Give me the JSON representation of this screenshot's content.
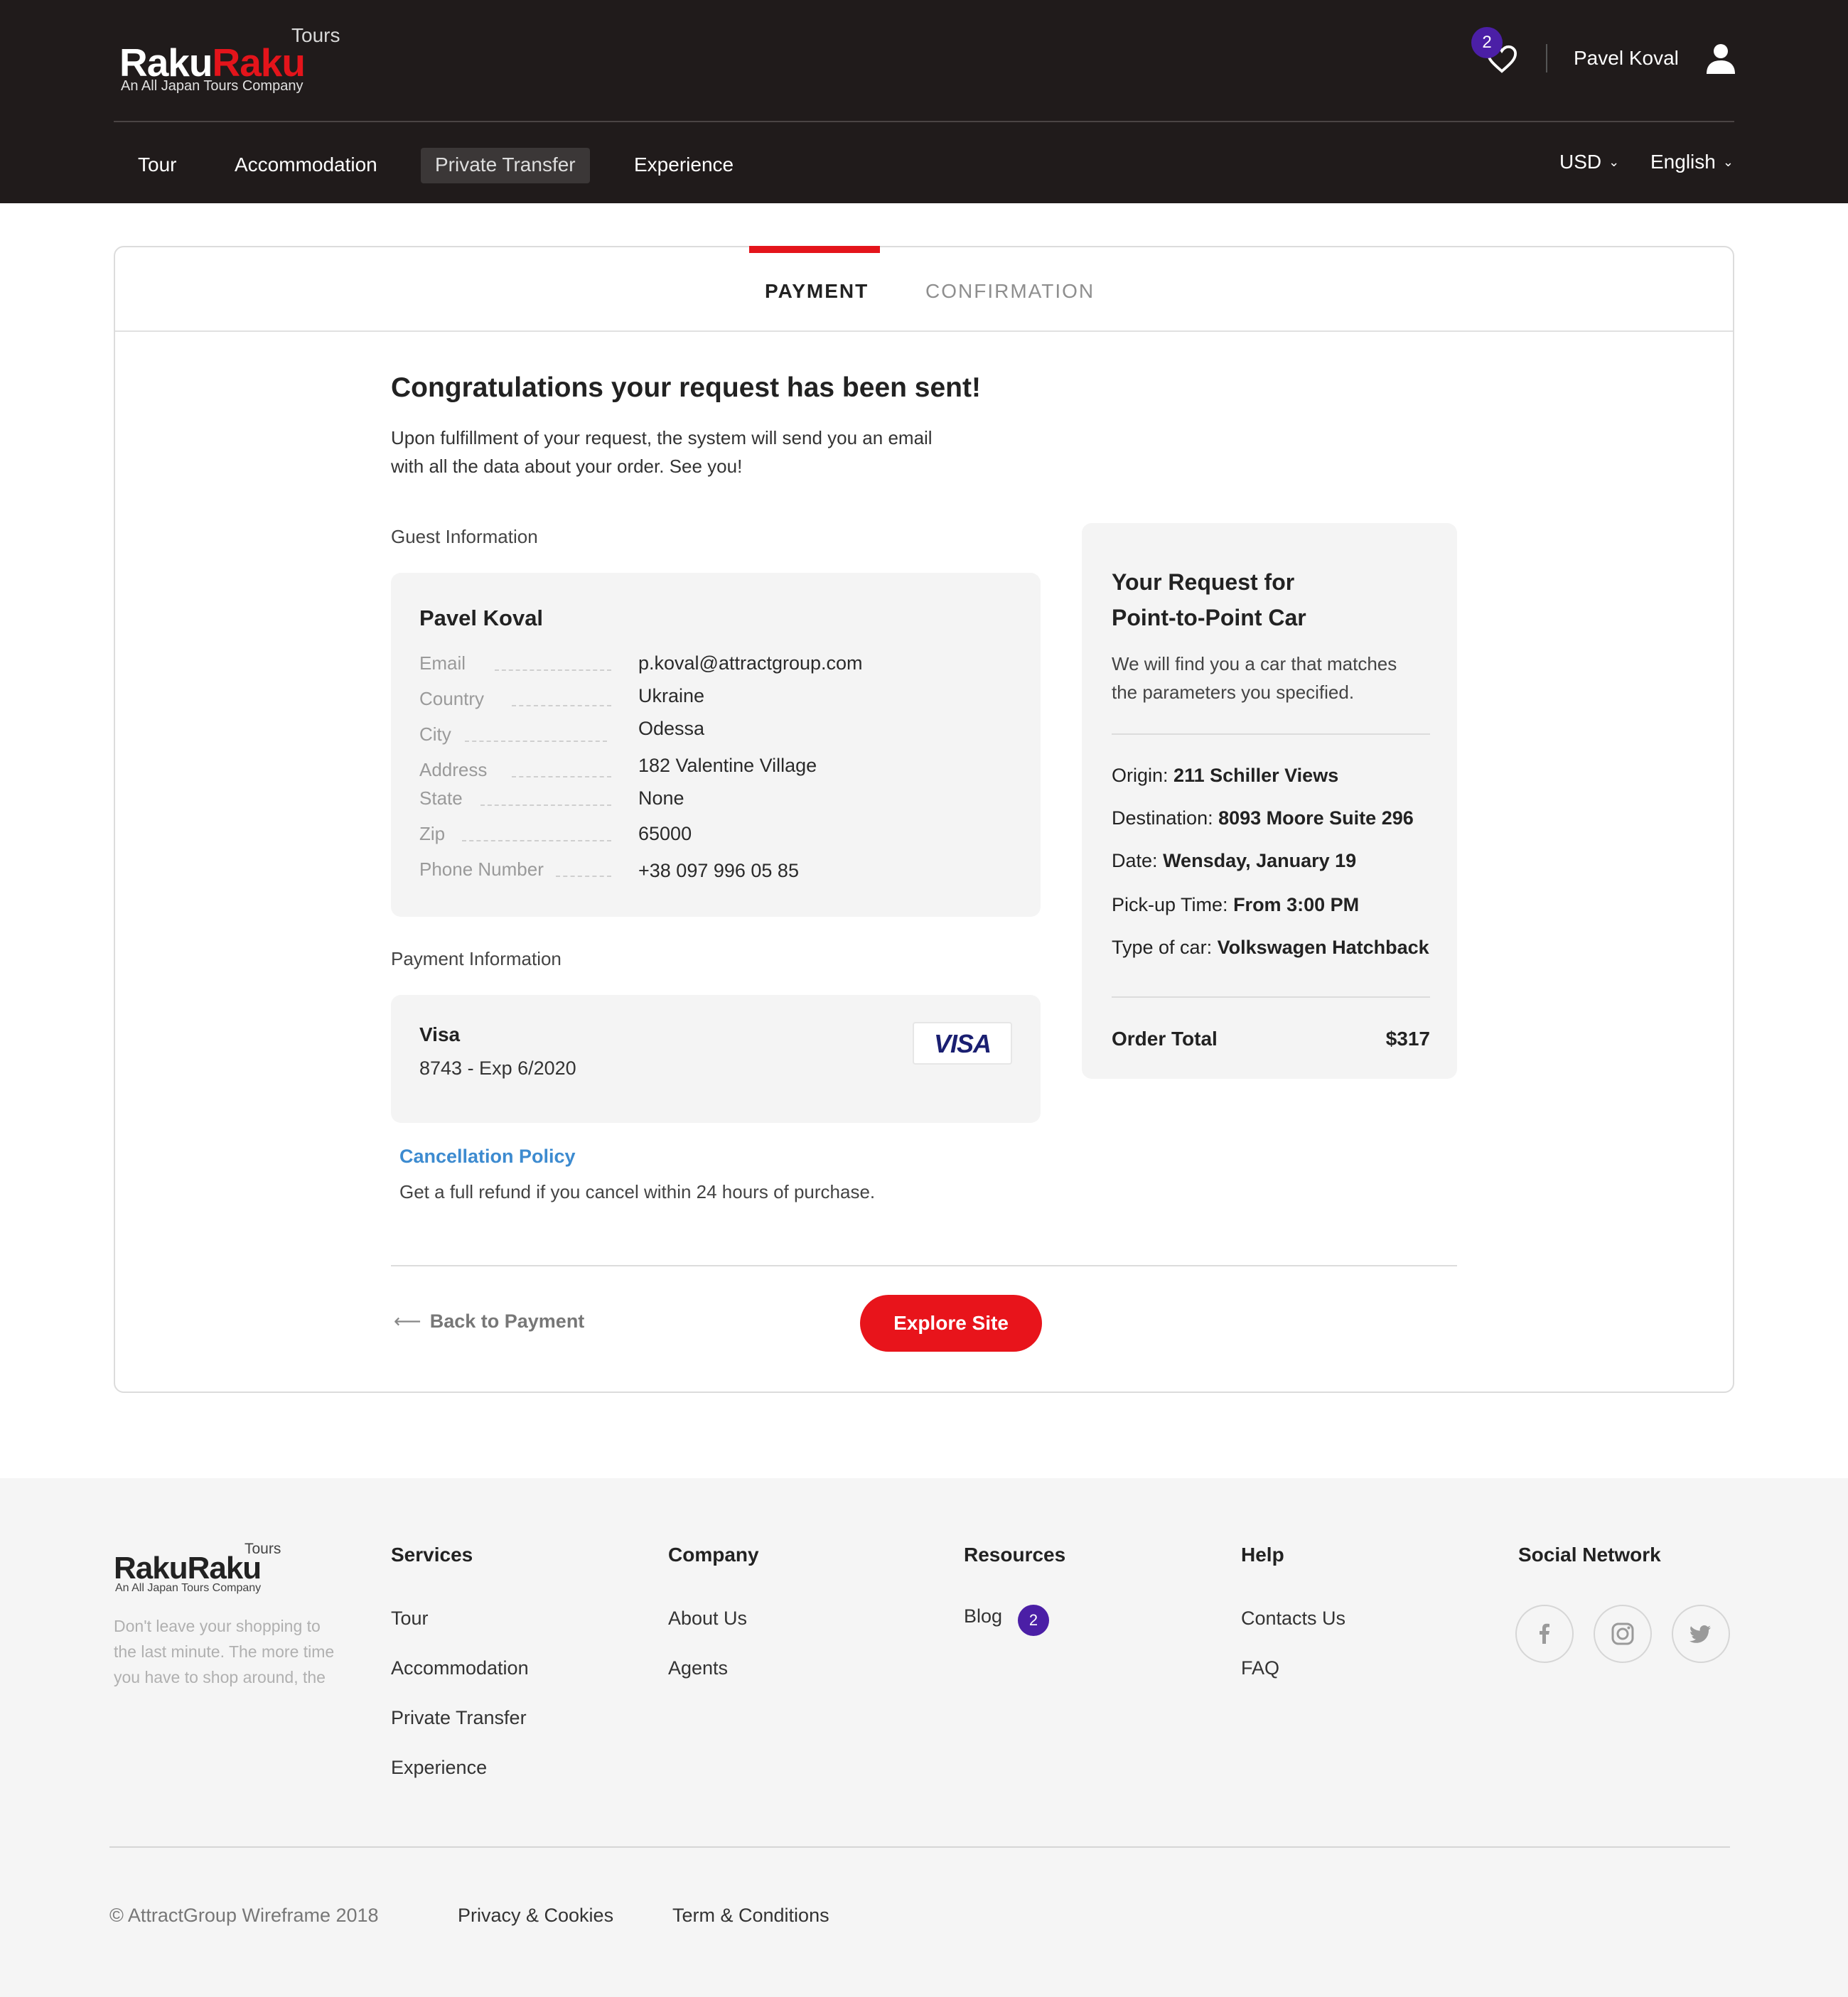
{
  "header": {
    "logo": {
      "tours": "Tours",
      "brand_white": "Raku",
      "brand_red": "Raku",
      "tagline": "An All Japan Tours Company"
    },
    "favorites_count": "2",
    "user_name": "Pavel Koval",
    "nav": [
      {
        "label": "Tour"
      },
      {
        "label": "Accommodation"
      },
      {
        "label": "Private Transfer",
        "active": true
      },
      {
        "label": "Experience"
      }
    ],
    "currency": "USD",
    "language": "English"
  },
  "steps": {
    "payment": "PAYMENT",
    "confirmation": "CONFIRMATION"
  },
  "confirmation": {
    "title": "Congratulations your request has been sent!",
    "intro_line1": "Upon fulfillment of your request, the system will send you an email",
    "intro_line2": "with all the data about your order. See you!"
  },
  "guest": {
    "section_label": "Guest Information",
    "name": "Pavel Koval",
    "rows": [
      {
        "label": "Email",
        "value": "p.koval@attractgroup.com"
      },
      {
        "label": "Country",
        "value": "Ukraine"
      },
      {
        "label": "City",
        "value": "Odessa"
      },
      {
        "label": "Address",
        "value": "182 Valentine Village"
      },
      {
        "label": "State",
        "value": "None"
      },
      {
        "label": "Zip",
        "value": "65000"
      },
      {
        "label": "Phone Number",
        "value": "+38 097 996 05 85"
      }
    ]
  },
  "payment": {
    "section_label": "Payment Information",
    "card_brand": "Visa",
    "card_details": "8743 - Exp 6/2020",
    "badge": "VISA"
  },
  "cancellation": {
    "title": "Cancellation Policy",
    "text": "Get a full refund if you cancel within 24 hours of purchase."
  },
  "request": {
    "title_line1": "Your Request for",
    "title_line2": "Point-to-Point Car",
    "desc_line1": "We will find you a car that matches",
    "desc_line2": "the parameters you specified.",
    "rows": [
      {
        "label": "Origin:",
        "value": "211 Schiller Views"
      },
      {
        "label": "Destination:",
        "value": "8093 Moore Suite 296"
      },
      {
        "label": "Date:",
        "value": "Wensday, January 19"
      },
      {
        "label": "Pick-up Time:",
        "value": "From 3:00 PM"
      },
      {
        "label": "Type of car:",
        "value": "Volkswagen Hatchback"
      }
    ],
    "total_label": "Order Total",
    "total_value": "$317"
  },
  "actions": {
    "back": "Back to Payment",
    "explore": "Explore Site"
  },
  "footer": {
    "logo": {
      "tours": "Tours",
      "brand": "RakuRaku",
      "tagline": "An All Japan Tours Company"
    },
    "blurb_line1": "Don't leave your shopping to",
    "blurb_line2": "the last minute. The more time",
    "blurb_line3": "you have to shop around, the",
    "columns": {
      "services": {
        "title": "Services",
        "links": [
          "Tour",
          "Accommodation",
          "Private Transfer",
          "Experience"
        ]
      },
      "company": {
        "title": "Company",
        "links": [
          "About Us",
          "Agents"
        ]
      },
      "resources": {
        "title": "Resources",
        "links": [
          "Blog"
        ],
        "blog_badge": "2"
      },
      "help": {
        "title": "Help",
        "links": [
          "Contacts Us",
          "FAQ"
        ]
      },
      "social": {
        "title": "Social Network",
        "icons": [
          "facebook-icon",
          "instagram-icon",
          "twitter-icon"
        ]
      }
    },
    "copyright": "© AttractGroup Wireframe  2018",
    "privacy": "Privacy & Cookies",
    "terms": "Term & Conditions"
  }
}
